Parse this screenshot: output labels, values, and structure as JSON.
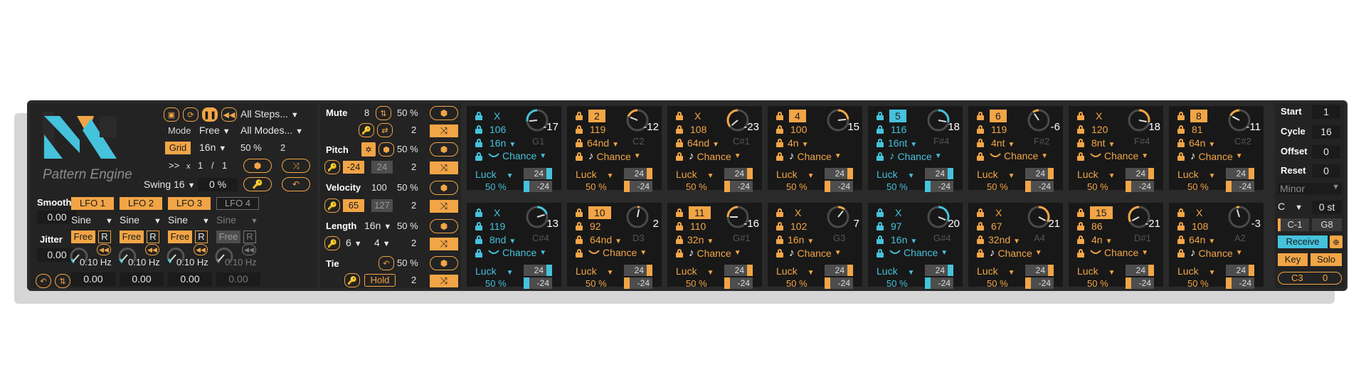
{
  "app": {
    "logo_text": "Pattern Engine"
  },
  "colors": {
    "orange": "#f2a546",
    "cyan": "#45c2dc",
    "dark": "#181818",
    "panel": "#232323"
  },
  "left": {
    "mode_label": "Mode",
    "mode_value": "Free",
    "grid_label": "Grid",
    "grid_value": "16n",
    "grid_percent": "50 %",
    "grid_number": "2",
    "all_steps": "All Steps...",
    "all_modes": "All Modes...",
    "ratio_prefix": ">>",
    "ratio_x": "x",
    "ratio_a": "1",
    "ratio_slash": "/",
    "ratio_b": "1",
    "swing_value": "Swing 16",
    "swing_amount": "0 %",
    "smooth_label": "Smooth",
    "smooth_value": "0.00",
    "jitter_label": "Jitter",
    "jitter_value": "0.00",
    "lfos": [
      {
        "name": "LFO 1",
        "wave": "Sine",
        "mode": "Free",
        "r": "R",
        "rate": "0.10 Hz",
        "amount": "0.00",
        "active": true
      },
      {
        "name": "LFO 2",
        "wave": "Sine",
        "mode": "Free",
        "r": "R",
        "rate": "0.10 Hz",
        "amount": "0.00",
        "active": true
      },
      {
        "name": "LFO 3",
        "wave": "Sine",
        "mode": "Free",
        "r": "R",
        "rate": "0.10 Hz",
        "amount": "0.00",
        "active": true
      },
      {
        "name": "LFO 4",
        "wave": "Sine",
        "mode": "Free",
        "r": "R",
        "rate": "0.10 Hz",
        "amount": "0.00",
        "active": false
      }
    ]
  },
  "params": {
    "mute": {
      "label": "Mute",
      "value": "8",
      "percent": "50 %",
      "number": "2"
    },
    "pitch": {
      "label": "Pitch",
      "percent": "50 %",
      "min": "-24",
      "max": "24",
      "number": "2"
    },
    "velocity": {
      "label": "Velocity",
      "value": "100",
      "percent": "50 %",
      "min": "65",
      "max": "127",
      "number": "2"
    },
    "length": {
      "label": "Length",
      "value": "16n",
      "percent": "50 %",
      "sub_a": "6",
      "sub_b": "4",
      "number": "2"
    },
    "tie": {
      "label": "Tie",
      "percent": "50 %",
      "hold": "Hold",
      "number": "2"
    }
  },
  "steps": [
    {
      "id": "X",
      "hl": false,
      "vel": "106",
      "len": "16n",
      "note": "G1",
      "rot": "-17",
      "luck": "Luck",
      "pct": "50 %",
      "chance": "Chance",
      "cyan": true,
      "mode": "curve"
    },
    {
      "id": "2",
      "hl": true,
      "vel": "119",
      "len": "64nd",
      "note": "C2",
      "rot": "-12",
      "luck": "Luck",
      "pct": "50 %",
      "chance": "Chance",
      "cyan": false,
      "mode": "note"
    },
    {
      "id": "X",
      "hl": false,
      "vel": "108",
      "len": "64nd",
      "note": "C#1",
      "rot": "-23",
      "luck": "Luck",
      "pct": "50 %",
      "chance": "Chance",
      "cyan": false,
      "mode": "note"
    },
    {
      "id": "4",
      "hl": true,
      "vel": "100",
      "len": "4n",
      "note": "",
      "rot": "15",
      "luck": "Luck",
      "pct": "50 %",
      "chance": "Chance",
      "cyan": false,
      "mode": "note"
    },
    {
      "id": "5",
      "hl": true,
      "vel": "116",
      "len": "16nt",
      "note": "F#4",
      "rot": "18",
      "luck": "Luck",
      "pct": "50 %",
      "chance": "Chance",
      "cyan": true,
      "mode": "note"
    },
    {
      "id": "6",
      "hl": true,
      "vel": "119",
      "len": "4nt",
      "note": "F#2",
      "rot": "-6",
      "luck": "Luck",
      "pct": "50 %",
      "chance": "Chance",
      "cyan": false,
      "mode": "curve"
    },
    {
      "id": "X",
      "hl": false,
      "vel": "120",
      "len": "8nt",
      "note": "F#4",
      "rot": "18",
      "luck": "Luck",
      "pct": "50 %",
      "chance": "Chance",
      "cyan": false,
      "mode": "curve"
    },
    {
      "id": "8",
      "hl": true,
      "vel": "81",
      "len": "64n",
      "note": "C#2",
      "rot": "-11",
      "luck": "Luck",
      "pct": "50 %",
      "chance": "Chance",
      "cyan": false,
      "mode": "note"
    },
    {
      "id": "X",
      "hl": false,
      "vel": "119",
      "len": "8nd",
      "note": "C#4",
      "rot": "13",
      "luck": "Luck",
      "pct": "50 %",
      "chance": "Chance",
      "cyan": true,
      "mode": "curve"
    },
    {
      "id": "10",
      "hl": true,
      "vel": "92",
      "len": "64nd",
      "note": "D3",
      "rot": "2",
      "luck": "Luck",
      "pct": "50 %",
      "chance": "Chance",
      "cyan": false,
      "mode": "curve"
    },
    {
      "id": "11",
      "hl": true,
      "vel": "110",
      "len": "32n",
      "note": "G#1",
      "rot": "-16",
      "luck": "Luck",
      "pct": "50 %",
      "chance": "Chance",
      "cyan": false,
      "mode": "note"
    },
    {
      "id": "X",
      "hl": false,
      "vel": "102",
      "len": "16n",
      "note": "G3",
      "rot": "7",
      "luck": "Luck",
      "pct": "50 %",
      "chance": "Chance",
      "cyan": false,
      "mode": "note"
    },
    {
      "id": "X",
      "hl": false,
      "vel": "97",
      "len": "16n",
      "note": "G#4",
      "rot": "20",
      "luck": "Luck",
      "pct": "50 %",
      "chance": "Chance",
      "cyan": true,
      "mode": "curve"
    },
    {
      "id": "X",
      "hl": false,
      "vel": "67",
      "len": "32nd",
      "note": "A4",
      "rot": "21",
      "luck": "Luck",
      "pct": "50 %",
      "chance": "Chance",
      "cyan": false,
      "mode": "note"
    },
    {
      "id": "15",
      "hl": true,
      "vel": "86",
      "len": "4n",
      "note": "D#1",
      "rot": "-21",
      "luck": "Luck",
      "pct": "50 %",
      "chance": "Chance",
      "cyan": false,
      "mode": "curve"
    },
    {
      "id": "X",
      "hl": false,
      "vel": "108",
      "len": "64n",
      "note": "A2",
      "rot": "-3",
      "luck": "Luck",
      "pct": "50 %",
      "chance": "Chance",
      "cyan": false,
      "mode": "note"
    }
  ],
  "step_bar": {
    "top": "24",
    "bottom": "-24"
  },
  "right": {
    "start_label": "Start",
    "start_value": "1",
    "cycle_label": "Cycle",
    "cycle_value": "16",
    "offset_label": "Offset",
    "offset_value": "0",
    "reset_label": "Reset",
    "reset_value": "0",
    "scale": "Minor",
    "root": "C",
    "transpose": "0 st",
    "range_low": "C-1",
    "range_high": "G8",
    "receive": "Receive",
    "key": "Key",
    "solo": "Solo",
    "note": "C3",
    "note_value": "0"
  }
}
